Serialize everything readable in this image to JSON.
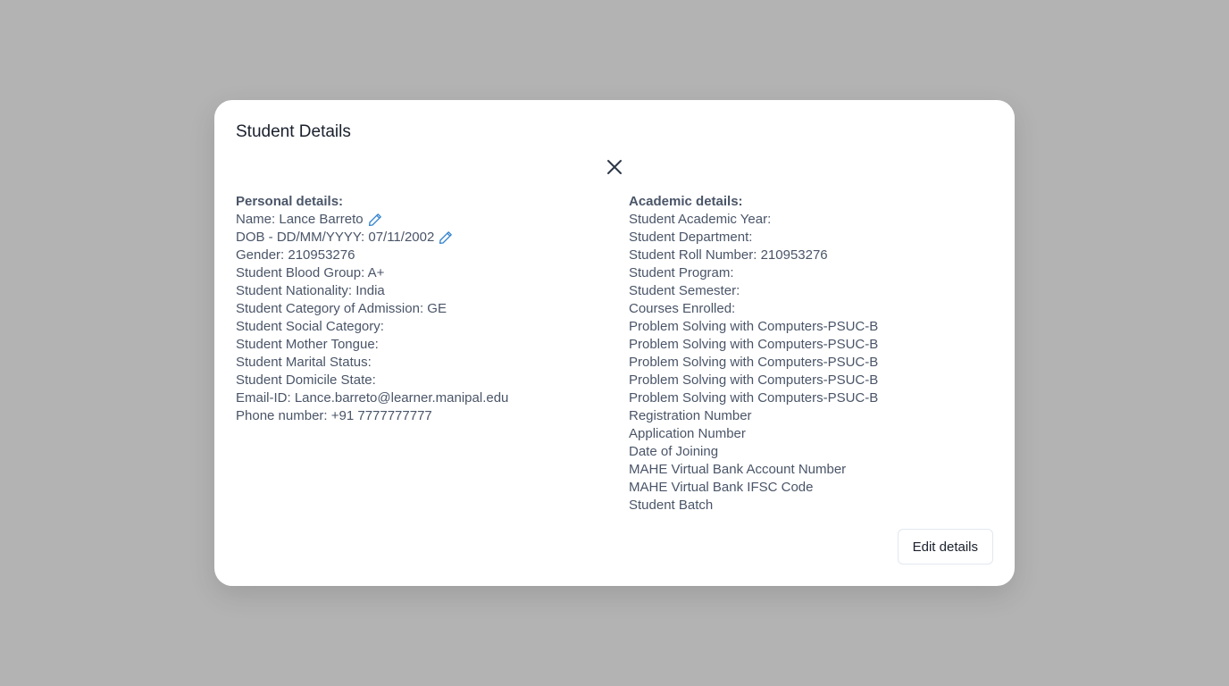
{
  "modal": {
    "title": "Student Details",
    "close_icon": "close-icon",
    "edit_icon": "pencil-icon",
    "edit_button_label": "Edit details"
  },
  "personal": {
    "heading": "Personal details:",
    "name": "Name: Lance Barreto",
    "dob": "DOB - DD/MM/YYYY: 07/11/2002",
    "fields": [
      "Gender: 210953276",
      "Student Blood Group: A+",
      "Student Nationality: India",
      "Student Category of Admission: GE",
      "Student Social Category:",
      "Student Mother Tongue:",
      "Student Marital Status:",
      "Student Domicile State:",
      "Email-ID: Lance.barreto@learner.manipal.edu",
      "Phone number: +91 7777777777"
    ]
  },
  "academic": {
    "heading": "Academic details:",
    "fields": [
      "Student Academic Year:",
      "Student Department:",
      "Student Roll Number: 210953276",
      "Student Program:",
      "Student Semester:",
      "Courses Enrolled:",
      "Problem Solving with Computers-PSUC-B",
      "Problem Solving with Computers-PSUC-B",
      "Problem Solving with Computers-PSUC-B",
      "Problem Solving with Computers-PSUC-B",
      "Problem Solving with Computers-PSUC-B",
      "Registration Number",
      "Application Number",
      "Date of Joining",
      "MAHE Virtual Bank Account Number",
      "MAHE Virtual Bank IFSC Code",
      "Student Batch"
    ]
  },
  "colors": {
    "overlay": "#b3b3b3",
    "text": "#4a5568",
    "title": "#1a202c",
    "accent": "#3182ce"
  }
}
